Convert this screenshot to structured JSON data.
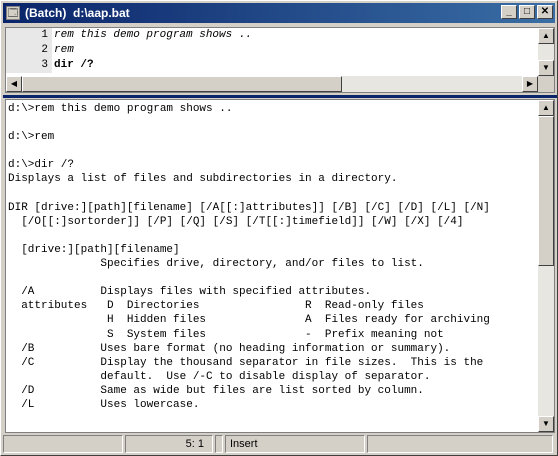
{
  "window": {
    "title": "(Batch)  d:\\aap.bat"
  },
  "titlebar_buttons": {
    "minimize": "_",
    "maximize": "□",
    "close": "✕"
  },
  "editor": {
    "lines": [
      {
        "num": "1",
        "text": "rem this demo program shows .."
      },
      {
        "num": "2",
        "text": "rem"
      },
      {
        "num": "3",
        "text": "dir /?"
      }
    ]
  },
  "output": {
    "text": "d:\\>rem this demo program shows ..\n\nd:\\>rem\n\nd:\\>dir /?\nDisplays a list of files and subdirectories in a directory.\n\nDIR [drive:][path][filename] [/A[[:]attributes]] [/B] [/C] [/D] [/L] [/N]\n  [/O[[:]sortorder]] [/P] [/Q] [/S] [/T[[:]timefield]] [/W] [/X] [/4]\n\n  [drive:][path][filename]\n              Specifies drive, directory, and/or files to list.\n\n  /A          Displays files with specified attributes.\n  attributes   D  Directories                R  Read-only files\n               H  Hidden files               A  Files ready for archiving\n               S  System files               -  Prefix meaning not\n  /B          Uses bare format (no heading information or summary).\n  /C          Display the thousand separator in file sizes.  This is the\n              default.  Use /-C to disable display of separator.\n  /D          Same as wide but files are list sorted by column.\n  /L          Uses lowercase."
  },
  "statusbar": {
    "panel1": "",
    "position": "5:  1",
    "panel3": "",
    "mode": "Insert",
    "panel5": ""
  },
  "icons": {
    "app": "🗔",
    "scroll_up": "▲",
    "scroll_down": "▼",
    "scroll_left": "◀",
    "scroll_right": "▶"
  }
}
